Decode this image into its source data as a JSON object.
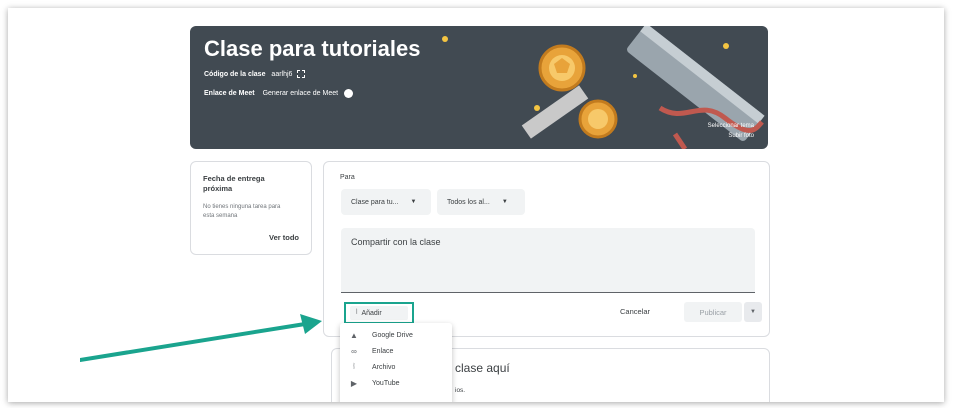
{
  "banner": {
    "title": "Clase para tutoriales",
    "code_label": "Código de la clase",
    "code_value": "aarlhj6",
    "meet_label": "Enlace de Meet",
    "meet_value": "Generar enlace de Meet",
    "select_theme": "Seleccionar tema",
    "upload_photo": "Subir foto"
  },
  "upcoming": {
    "title": "Fecha de entrega próxima",
    "text": "No tienes ninguna tarea para esta semana",
    "link": "Ver todo"
  },
  "post": {
    "for_label": "Para",
    "class_dropdown": "Clase para tu...",
    "students_dropdown": "Todos los al...",
    "placeholder": "Compartir con la clase",
    "add_label": "Añadir",
    "cancel_label": "Cancelar",
    "publish_label": "Publicar"
  },
  "add_menu": {
    "items": [
      {
        "label": "Google Drive",
        "icon": "google-drive-icon"
      },
      {
        "label": "Enlace",
        "icon": "link-icon"
      },
      {
        "label": "Archivo",
        "icon": "attach-file-icon"
      },
      {
        "label": "YouTube",
        "icon": "youtube-icon"
      }
    ]
  },
  "stream": {
    "title": "clase aquí",
    "subtitle": "ios."
  },
  "colors": {
    "banner": "#414a52",
    "highlight": "#1aa48e",
    "arrow": "#1aa48e"
  }
}
